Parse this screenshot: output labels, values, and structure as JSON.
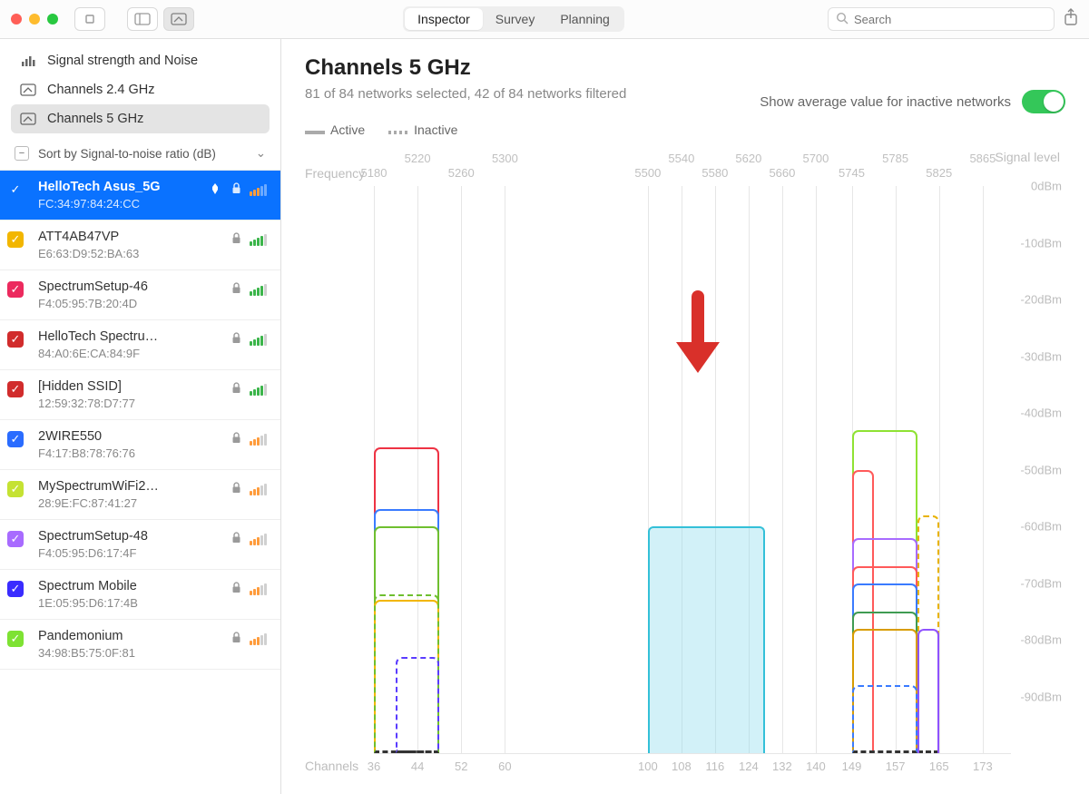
{
  "window": {
    "tabs": [
      "Inspector",
      "Survey",
      "Planning"
    ],
    "active_tab": 0,
    "search_placeholder": "Search"
  },
  "sidebar_nav": [
    {
      "label": "Signal strength and Noise",
      "icon": "bars-icon"
    },
    {
      "label": "Channels 2.4 GHz",
      "icon": "channel-icon"
    },
    {
      "label": "Channels 5 GHz",
      "icon": "channel-icon"
    }
  ],
  "sidebar_nav_active": 2,
  "sort_label": "Sort by Signal-to-noise ratio (dB)",
  "networks": [
    {
      "name": "HelloTech Asus_5G",
      "mac": "FC:34:97:84:24:CC",
      "color": "#0a72ff",
      "pinned": true,
      "locked": true,
      "signal_style": "orange",
      "selected": true
    },
    {
      "name": "ATT4AB47VP",
      "mac": "E6:63:D9:52:BA:63",
      "color": "#f2b600",
      "locked": true,
      "signal_style": "green"
    },
    {
      "name": "SpectrumSetup-46",
      "mac": "F4:05:95:7B:20:4D",
      "color": "#ec2a5e",
      "locked": true,
      "signal_style": "green"
    },
    {
      "name": "HelloTech Spectru…",
      "mac": "84:A0:6E:CA:84:9F",
      "color": "#d12c2c",
      "locked": true,
      "signal_style": "green"
    },
    {
      "name": "[Hidden SSID]",
      "mac": "12:59:32:78:D7:77",
      "color": "#d12c2c",
      "locked": true,
      "signal_style": "green"
    },
    {
      "name": "2WIRE550",
      "mac": "F4:17:B8:78:76:76",
      "color": "#2a6cff",
      "locked": true,
      "signal_style": "orange"
    },
    {
      "name": "MySpectrumWiFi2…",
      "mac": "28:9E:FC:87:41:27",
      "color": "#c5e233",
      "locked": true,
      "signal_style": "orange"
    },
    {
      "name": "SpectrumSetup-48",
      "mac": "F4:05:95:D6:17:4F",
      "color": "#a86bff",
      "locked": true,
      "signal_style": "orange"
    },
    {
      "name": "Spectrum Mobile",
      "mac": "1E:05:95:D6:17:4B",
      "color": "#3a2cff",
      "locked": true,
      "signal_style": "orange"
    },
    {
      "name": "Pandemonium",
      "mac": "34:98:B5:75:0F:81",
      "color": "#7ee233",
      "locked": true,
      "signal_style": "orange"
    }
  ],
  "main": {
    "title": "Channels 5 GHz",
    "subtitle": "81 of 84 networks selected, 42 of 84 networks filtered",
    "avg_label": "Show average value for inactive networks",
    "legend_active": "Active",
    "legend_inactive": "Inactive"
  },
  "chart_data": {
    "type": "line",
    "frequency_title": "Frequency",
    "frequency_ticks_top": [
      5180,
      5220,
      5260,
      5300,
      5500,
      5540,
      5580,
      5620,
      5660,
      5700,
      5745,
      5785,
      5825,
      5865
    ],
    "signal_level_title": "Signal level",
    "y_ticks_dbm": [
      0,
      -10,
      -20,
      -30,
      -40,
      -50,
      -60,
      -70,
      -80,
      -90
    ],
    "y_unit": "dBm",
    "channels_title": "Channels",
    "channel_ticks": [
      36,
      44,
      52,
      60,
      100,
      108,
      116,
      124,
      132,
      140,
      149,
      157,
      165,
      173
    ],
    "bands": [
      {
        "start": 36,
        "end": 64
      },
      {
        "start": 100,
        "end": 144
      },
      {
        "start": 149,
        "end": 177
      }
    ],
    "highlight_fill": {
      "channel_start": 100,
      "channel_end": 128,
      "top_dbm": -60,
      "color": "#7fd8ea"
    },
    "arrow_annotation": {
      "channel": 112,
      "top_dbm": -40
    },
    "series": [
      {
        "color": "#e34",
        "dashed": false,
        "channel_start": 36,
        "channel_end": 48,
        "peak_dbm": -46
      },
      {
        "color": "#3a7bff",
        "dashed": false,
        "channel_start": 36,
        "channel_end": 48,
        "peak_dbm": -57
      },
      {
        "color": "#6fbf2f",
        "dashed": false,
        "channel_start": 36,
        "channel_end": 48,
        "peak_dbm": -60
      },
      {
        "color": "#f2b600",
        "dashed": false,
        "channel_start": 36,
        "channel_end": 48,
        "peak_dbm": -73
      },
      {
        "color": "#6fbf2f",
        "dashed": true,
        "channel_start": 36,
        "channel_end": 48,
        "peak_dbm": -72
      },
      {
        "color": "#5a3cff",
        "dashed": true,
        "channel_start": 40,
        "channel_end": 48,
        "peak_dbm": -83
      },
      {
        "color": "#34c0d8",
        "dashed": false,
        "channel_start": 100,
        "channel_end": 128,
        "peak_dbm": -60
      },
      {
        "color": "#8fe233",
        "dashed": false,
        "channel_start": 149,
        "channel_end": 161,
        "peak_dbm": -43
      },
      {
        "color": "#ff5a5a",
        "dashed": false,
        "channel_start": 149,
        "channel_end": 153,
        "peak_dbm": -50
      },
      {
        "color": "#a86bff",
        "dashed": false,
        "channel_start": 149,
        "channel_end": 161,
        "peak_dbm": -62
      },
      {
        "color": "#ff5a5a",
        "dashed": false,
        "channel_start": 149,
        "channel_end": 161,
        "peak_dbm": -67
      },
      {
        "color": "#3a7bff",
        "dashed": false,
        "channel_start": 149,
        "channel_end": 161,
        "peak_dbm": -70
      },
      {
        "color": "#3f9b52",
        "dashed": false,
        "channel_start": 149,
        "channel_end": 161,
        "peak_dbm": -75
      },
      {
        "color": "#e8b200",
        "dashed": true,
        "channel_start": 161,
        "channel_end": 165,
        "peak_dbm": -58
      },
      {
        "color": "#d89c00",
        "dashed": false,
        "channel_start": 149,
        "channel_end": 161,
        "peak_dbm": -78
      },
      {
        "color": "#8f52ff",
        "dashed": false,
        "channel_start": 161,
        "channel_end": 165,
        "peak_dbm": -78
      },
      {
        "color": "#3a7bff",
        "dashed": true,
        "channel_start": 149,
        "channel_end": 161,
        "peak_dbm": -88
      }
    ]
  }
}
